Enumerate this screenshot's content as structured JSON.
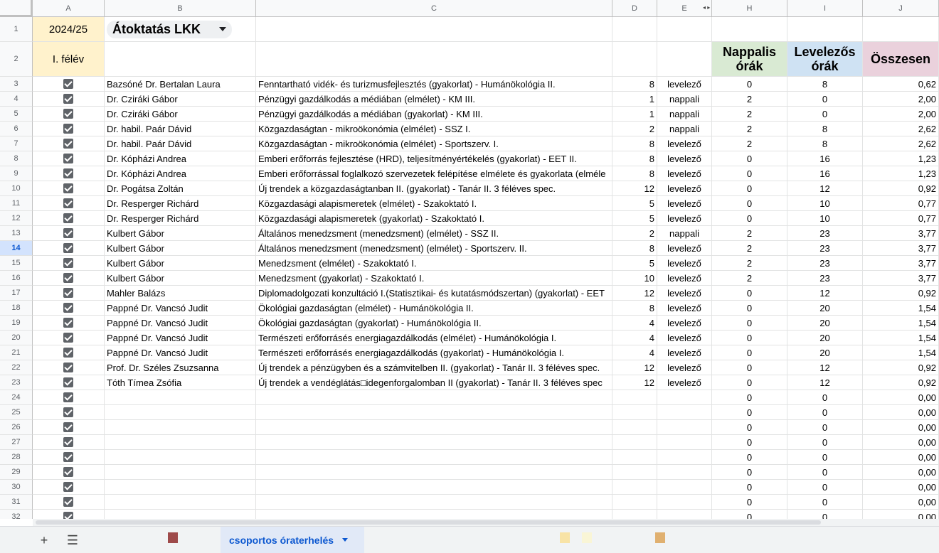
{
  "columns": [
    "A",
    "B",
    "C",
    "D",
    "E",
    "H",
    "I",
    "J"
  ],
  "header": {
    "year": "2024/25",
    "dropdown_label": "Átoktatás LKK",
    "semester": "I. félév",
    "h_title": "Nappalis órák",
    "i_title": "Levelezős órák",
    "j_title": "Összesen"
  },
  "colors": {
    "year_fill": "#fff2cc",
    "h_fill": "#d9ead3",
    "i_fill": "#cfe2f3",
    "j_fill": "#ead1dc",
    "selected_row": "#d3e3fd",
    "tab_active": "#0b57d0"
  },
  "rows": [
    {
      "num": "3",
      "checked": true,
      "name": "Bazsóné Dr. Bertalan Laura",
      "course": "Fenntartható vidék- és turizmusfejlesztés (gyakorlat) - Humánökológia II.",
      "d": "8",
      "e": "levelező",
      "h": "0",
      "i": "8",
      "j": "0,62"
    },
    {
      "num": "4",
      "checked": true,
      "name": "Dr. Cziráki Gábor",
      "course": "Pénzügyi gazdálkodás a médiában (elmélet) - KM III.",
      "d": "1",
      "e": "nappali",
      "h": "2",
      "i": "0",
      "j": "2,00"
    },
    {
      "num": "5",
      "checked": true,
      "name": "Dr. Cziráki Gábor",
      "course": "Pénzügyi gazdálkodás a médiában (gyakorlat) - KM III.",
      "d": "1",
      "e": "nappali",
      "h": "2",
      "i": "0",
      "j": "2,00"
    },
    {
      "num": "6",
      "checked": true,
      "name": "Dr. habil. Paár Dávid",
      "course": "Közgazdaságtan - mikroökonómia (elmélet) - SSZ I.",
      "d": "2",
      "e": "nappali",
      "h": "2",
      "i": "8",
      "j": "2,62"
    },
    {
      "num": "7",
      "checked": true,
      "name": "Dr. habil. Paár Dávid",
      "course": "Közgazdaságtan - mikroökonómia (elmélet) - Sportszerv. I.",
      "d": "8",
      "e": "levelező",
      "h": "2",
      "i": "8",
      "j": "2,62"
    },
    {
      "num": "8",
      "checked": true,
      "name": "Dr. Kópházi Andrea",
      "course": "Emberi erőforrás fejlesztése (HRD), teljesítményértékelés (gyakorlat) - EET II.",
      "d": "8",
      "e": "levelező",
      "h": "0",
      "i": "16",
      "j": "1,23"
    },
    {
      "num": "9",
      "checked": true,
      "name": "Dr. Kópházi Andrea",
      "course": "Emberi erőforrással foglalkozó szervezetek felépítése elmélete és gyakorlata (elméle",
      "d": "8",
      "e": "levelező",
      "h": "0",
      "i": "16",
      "j": "1,23"
    },
    {
      "num": "10",
      "checked": true,
      "name": "Dr. Pogátsa Zoltán",
      "course": "Új trendek a közgazdaságtanban II. (gyakorlat) - Tanár II. 3 féléves spec.",
      "d": "12",
      "e": "levelező",
      "h": "0",
      "i": "12",
      "j": "0,92"
    },
    {
      "num": "11",
      "checked": true,
      "name": "Dr. Resperger Richárd",
      "course": "Közgazdasági alapismeretek (elmélet) - Szakoktató I.",
      "d": "5",
      "e": "levelező",
      "h": "0",
      "i": "10",
      "j": "0,77"
    },
    {
      "num": "12",
      "checked": true,
      "name": "Dr. Resperger Richárd",
      "course": "Közgazdasági alapismeretek (gyakorlat) - Szakoktató I.",
      "d": "5",
      "e": "levelező",
      "h": "0",
      "i": "10",
      "j": "0,77"
    },
    {
      "num": "13",
      "checked": true,
      "name": "Kulbert Gábor",
      "course": "Általános menedzsment (menedzsment) (elmélet) - SSZ II.",
      "d": "2",
      "e": "nappali",
      "h": "2",
      "i": "23",
      "j": "3,77"
    },
    {
      "num": "14",
      "checked": true,
      "name": "Kulbert Gábor",
      "course": "Általános menedzsment (menedzsment) (elmélet) - Sportszerv. II.",
      "d": "8",
      "e": "levelező",
      "h": "2",
      "i": "23",
      "j": "3,77",
      "selected": true
    },
    {
      "num": "15",
      "checked": true,
      "name": "Kulbert Gábor",
      "course": "Menedzsment (elmélet) - Szakoktató I.",
      "d": "5",
      "e": "levelező",
      "h": "2",
      "i": "23",
      "j": "3,77"
    },
    {
      "num": "16",
      "checked": true,
      "name": "Kulbert Gábor",
      "course": "Menedzsment (gyakorlat) - Szakoktató I.",
      "d": "10",
      "e": "levelező",
      "h": "2",
      "i": "23",
      "j": "3,77"
    },
    {
      "num": "17",
      "checked": true,
      "name": "Mahler Balázs",
      "course": "Diplomadolgozati konzultáció I.(Statisztikai- és kutatásmódszertan) (gyakorlat) - EET",
      "d": "12",
      "e": "levelező",
      "h": "0",
      "i": "12",
      "j": "0,92"
    },
    {
      "num": "18",
      "checked": true,
      "name": "Pappné Dr. Vancsó Judit",
      "course": "Ökológiai gazdaságtan (elmélet) - Humánökológia II.",
      "d": "8",
      "e": "levelező",
      "h": "0",
      "i": "20",
      "j": "1,54"
    },
    {
      "num": "19",
      "checked": true,
      "name": "Pappné Dr. Vancsó Judit",
      "course": "Ökológiai gazdaságtan (gyakorlat) - Humánökológia II.",
      "d": "4",
      "e": "levelező",
      "h": "0",
      "i": "20",
      "j": "1,54"
    },
    {
      "num": "20",
      "checked": true,
      "name": "Pappné Dr. Vancsó Judit",
      "course": "Természeti erőforrásés energiagazdálkodás (elmélet) - Humánökológia I.",
      "d": "4",
      "e": "levelező",
      "h": "0",
      "i": "20",
      "j": "1,54"
    },
    {
      "num": "21",
      "checked": true,
      "name": "Pappné Dr. Vancsó Judit",
      "course": "Természeti erőforrásés energiagazdálkodás (gyakorlat) - Humánökológia I.",
      "d": "4",
      "e": "levelező",
      "h": "0",
      "i": "20",
      "j": "1,54"
    },
    {
      "num": "22",
      "checked": true,
      "name": "Prof. Dr. Széles Zsuzsanna",
      "course": "Új trendek a pénzügyben és a számvitelben II. (gyakorlat) - Tanár II. 3 féléves spec.",
      "d": "12",
      "e": "levelező",
      "h": "0",
      "i": "12",
      "j": "0,92"
    },
    {
      "num": "23",
      "checked": true,
      "name": "Tóth Tímea Zsófia",
      "course": "Új trendek a vendéglátás□idegenforgalomban II (gyakorlat) - Tanár II. 3 féléves spec",
      "d": "12",
      "e": "levelező",
      "h": "0",
      "i": "12",
      "j": "0,92"
    },
    {
      "num": "24",
      "checked": true,
      "name": "",
      "course": "",
      "d": "",
      "e": "",
      "h": "0",
      "i": "0",
      "j": "0,00"
    },
    {
      "num": "25",
      "checked": true,
      "name": "",
      "course": "",
      "d": "",
      "e": "",
      "h": "0",
      "i": "0",
      "j": "0,00"
    },
    {
      "num": "26",
      "checked": true,
      "name": "",
      "course": "",
      "d": "",
      "e": "",
      "h": "0",
      "i": "0",
      "j": "0,00"
    },
    {
      "num": "27",
      "checked": true,
      "name": "",
      "course": "",
      "d": "",
      "e": "",
      "h": "0",
      "i": "0",
      "j": "0,00"
    },
    {
      "num": "28",
      "checked": true,
      "name": "",
      "course": "",
      "d": "",
      "e": "",
      "h": "0",
      "i": "0",
      "j": "0,00"
    },
    {
      "num": "29",
      "checked": true,
      "name": "",
      "course": "",
      "d": "",
      "e": "",
      "h": "0",
      "i": "0",
      "j": "0,00"
    },
    {
      "num": "30",
      "checked": true,
      "name": "",
      "course": "",
      "d": "",
      "e": "",
      "h": "0",
      "i": "0",
      "j": "0,00"
    },
    {
      "num": "31",
      "checked": true,
      "name": "",
      "course": "",
      "d": "",
      "e": "",
      "h": "0",
      "i": "0",
      "j": "0,00"
    },
    {
      "num": "32",
      "checked": true,
      "name": "",
      "course": "",
      "d": "",
      "e": "",
      "h": "0",
      "i": "0",
      "j": "0,00"
    }
  ],
  "tabbar": {
    "add_icon": "plus-icon",
    "menu_icon": "menu-icon",
    "active_tab": "csoportos óraterhelés",
    "swatches": [
      "#9e4a4a",
      "#f8e3a6",
      "#f9f5d6",
      "#e0b070"
    ]
  }
}
